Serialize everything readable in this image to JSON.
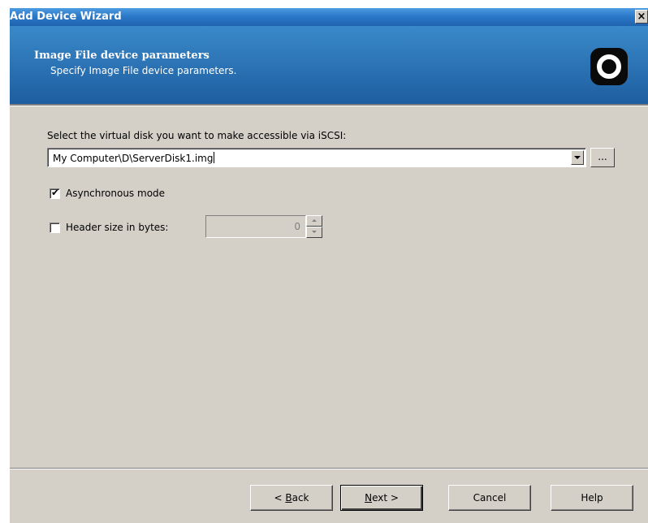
{
  "window": {
    "title": "Add Device Wizard",
    "close_label": "×"
  },
  "header": {
    "title": "Image File device parameters",
    "subtitle": "Specify Image File device parameters.",
    "logo_icon": "ring-logo-icon"
  },
  "form": {
    "disk_label": "Select the virtual disk you want to make accessible via iSCSI:",
    "disk_value": "My Computer\\D\\ServerDisk1.img",
    "browse_label": "...",
    "async_label": "Asynchronous mode",
    "async_checked": true,
    "header_size_label": "Header size in bytes:",
    "header_size_checked": false,
    "header_size_value": "0"
  },
  "buttons": {
    "back_pre": "< ",
    "back_u": "B",
    "back_post": "ack",
    "next_u": "N",
    "next_post": "ext >",
    "cancel": "Cancel",
    "help": "Help"
  },
  "colors": {
    "banner_top": "#3a89c9",
    "banner_bottom": "#1d5ea0",
    "face": "#d4d0c8"
  }
}
